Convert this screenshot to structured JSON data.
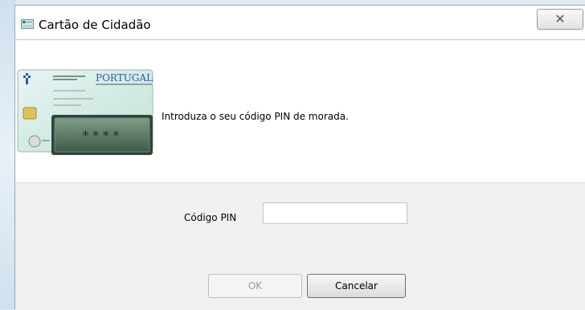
{
  "window": {
    "title": "Cartão de Cidadão",
    "close_glyph": "✕"
  },
  "header": {
    "prompt": "Introduza o seu código PIN de morada.",
    "card": {
      "country": "PORTUGAL",
      "masked_pin": "****",
      "icon": "id-card-pin-icon"
    }
  },
  "form": {
    "pin_label": "Código PIN",
    "pin_value": "",
    "ok_label": "OK",
    "cancel_label": "Cancelar"
  },
  "colors": {
    "card_green": "#9fd3b0",
    "pin_display": "#4f6b58"
  }
}
